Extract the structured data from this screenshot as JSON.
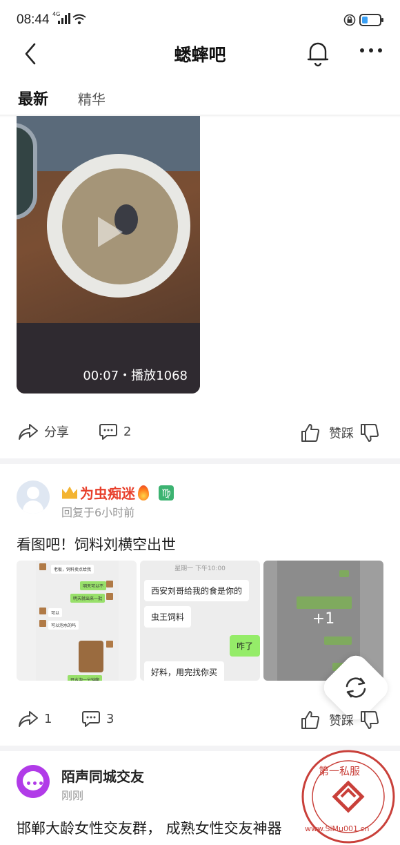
{
  "status": {
    "time": "08:44",
    "network": "4G"
  },
  "nav": {
    "title": "蟋蟀吧"
  },
  "tabs": [
    {
      "label": "最新"
    },
    {
      "label": "精华"
    }
  ],
  "video": {
    "meta": "00:07・播放1068"
  },
  "post1_actions": {
    "share_label": "分享",
    "comments": "2",
    "vote_label": "赞踩"
  },
  "post2": {
    "username": "为虫痴迷",
    "zodiac": "♍",
    "time": "回复于6小时前",
    "text": "看图吧！饲料刘横空出世",
    "images": {
      "a": {
        "bubbles": [
          "老板，饲料卖点给我",
          "明天可以不",
          "明天就出来一批",
          "可以",
          "可以泡水的吗",
          "开水泡一分钟啊"
        ]
      },
      "b": {
        "time": "星期一 下午10:00",
        "messages": [
          "西安刘哥给我的食是你的",
          "虫王饲料",
          "咋了",
          "好料，用完找你买"
        ]
      },
      "c": {
        "more_count": "+1"
      }
    },
    "shares": "1",
    "comments": "3",
    "vote_label": "赞踩"
  },
  "post3": {
    "username": "陌声同城交友",
    "time": "刚刚",
    "text": "邯郸大龄女性交友群， 成熟女性交友神器"
  },
  "watermark": {
    "text_top": "第一私服",
    "text_url": "www.SiMu001.cn"
  },
  "colors": {
    "username_red": "#e8402c",
    "zodiac_green": "#3cb371",
    "app_purple": "#b13be8",
    "separator": "#f3f3f5"
  }
}
